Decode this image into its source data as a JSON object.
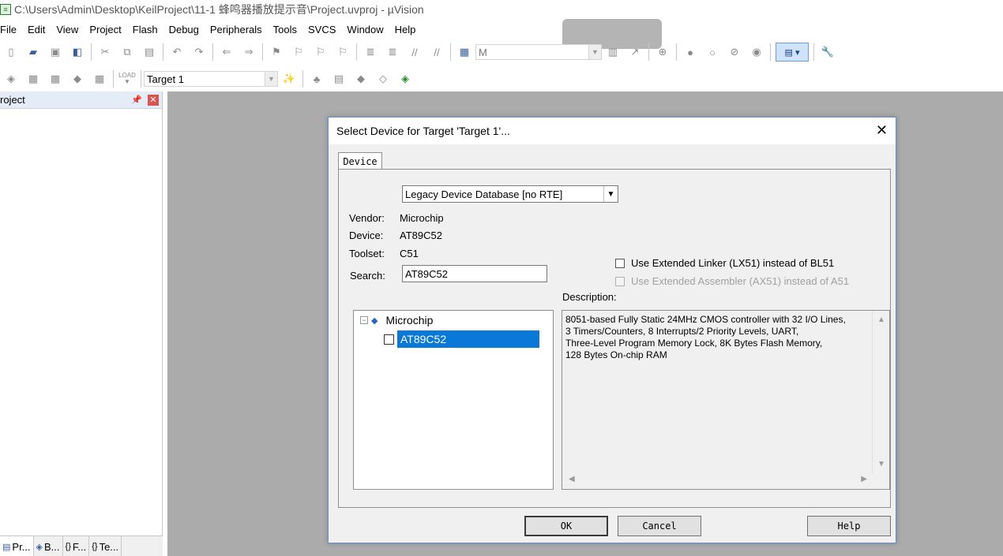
{
  "window": {
    "title": "C:\\Users\\Admin\\Desktop\\KeilProject\\11-1 蜂鸣器播放提示音\\Project.uvproj - µVision"
  },
  "menu": [
    "File",
    "Edit",
    "View",
    "Project",
    "Flash",
    "Debug",
    "Peripherals",
    "Tools",
    "SVCS",
    "Window",
    "Help"
  ],
  "toolbar1": {
    "find_combo_value": "M"
  },
  "toolbar2": {
    "load_label": "LOAD",
    "target_combo_value": "Target 1"
  },
  "project_panel": {
    "title": "roject",
    "pin_icon": "pin-icon",
    "tabs": [
      {
        "icon": "project-tab-icon",
        "label": "Pr..."
      },
      {
        "icon": "books-tab-icon",
        "label": "B..."
      },
      {
        "icon": "functions-tab-icon",
        "label": "F..."
      },
      {
        "icon": "templates-tab-icon",
        "label": "Te..."
      }
    ]
  },
  "dialog": {
    "title": "Select Device for Target 'Target 1'...",
    "close_glyph": "✕",
    "tab_label": "Device",
    "database_select": "Legacy Device Database [no RTE]",
    "vendor_label": "Vendor:",
    "vendor_value": "Microchip",
    "device_label": "Device:",
    "device_value": "AT89C52",
    "toolset_label": "Toolset:",
    "toolset_value": "C51",
    "search_label": "Search:",
    "search_value": "AT89C52",
    "option_linker": "Use Extended Linker (LX51) instead of BL51",
    "option_assembler": "Use Extended Assembler (AX51) instead of A51",
    "description_label": "Description:",
    "description_text": "8051-based Fully Static 24MHz CMOS controller with 32  I/O Lines,\n3 Timers/Counters, 8 Interrupts/2 Priority Levels, UART,\nThree-Level Program Memory Lock, 8K Bytes Flash Memory,\n128 Bytes On-chip RAM",
    "tree": {
      "root": "Microchip",
      "child": "AT89C52"
    },
    "buttons": {
      "ok": "OK",
      "cancel": "Cancel",
      "help": "Help"
    }
  }
}
